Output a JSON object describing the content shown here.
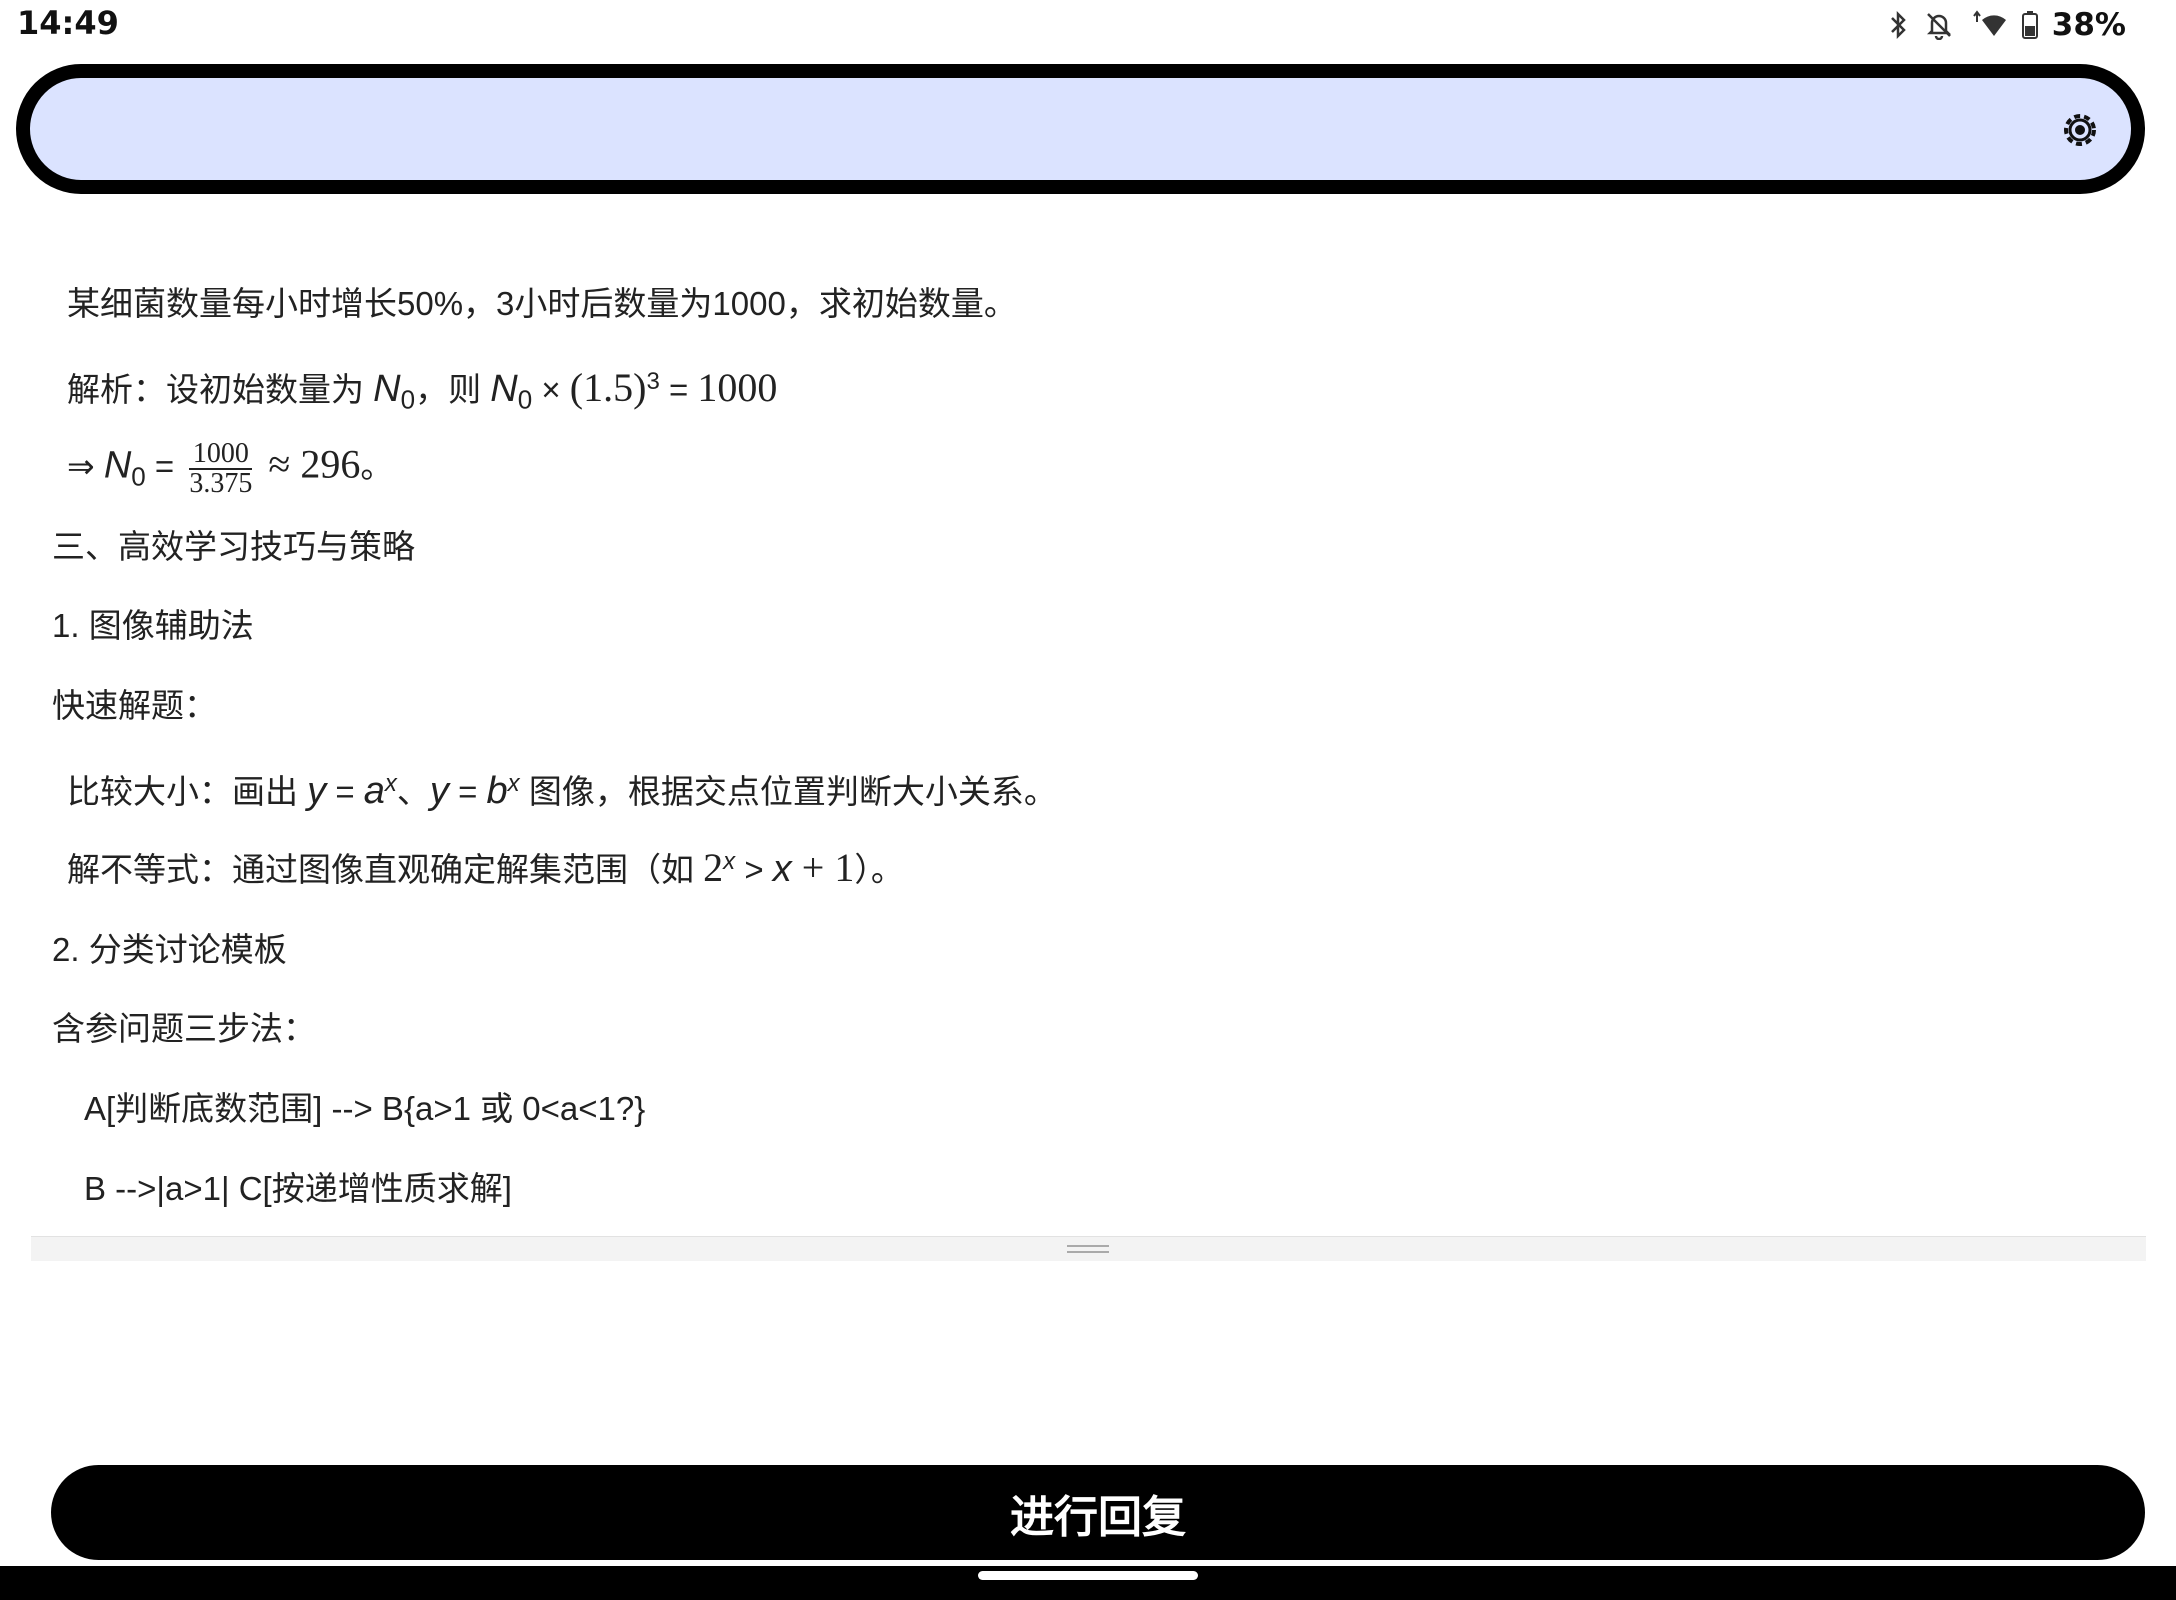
{
  "status_bar": {
    "time": "14:49",
    "battery": "38%",
    "icons": [
      "bluetooth-icon",
      "notifications-off-icon",
      "wifi-icon",
      "battery-icon"
    ]
  },
  "search_bar": {
    "settings_icon": "gear-icon",
    "fill_color": "#dbe3ff"
  },
  "content": {
    "problem": "某细菌数量每小时增长50%，3小时后数量为1000，求初始数量。",
    "analysis": {
      "prefix": "解析：设初始数量为 ",
      "var": "N",
      "sub": "0",
      "mid": "，则 ",
      "times": " × ",
      "base": "(1.5)",
      "exp": "3",
      "eq": " = ",
      "rhs": "1000"
    },
    "result": {
      "arrow": "⇒ ",
      "var": "N",
      "sub": "0",
      "eq": " = ",
      "num": "1000",
      "den": "3.375",
      "approx": " ≈ 296",
      "end": "。"
    },
    "section3_title": "三、高效学习技巧与策略",
    "item1_title": "1. 图像辅助法",
    "quick_solve": "快速解题：",
    "compare": {
      "prefix": "比较大小：画出 ",
      "y": "y",
      "eq": " = ",
      "a": "a",
      "sep": "、",
      "b": "b",
      "x": "x",
      "suffix": " 图像，根据交点位置判断大小关系。"
    },
    "inequality": {
      "prefix": "解不等式：通过图像直观确定解集范围（如 ",
      "two": "2",
      "x": "x",
      "gt": " > ",
      "plus": " + 1",
      "suffix": "）。"
    },
    "item2_title": "2. 分类讨论模板",
    "three_steps": "含参问题三步法：",
    "flow_line1": "A[判断底数范围] --> B{a>1 或 0<a<1?}",
    "flow_line2": "B -->|a>1| C[按递增性质求解]"
  },
  "reply_button": {
    "label": "进行回复"
  }
}
